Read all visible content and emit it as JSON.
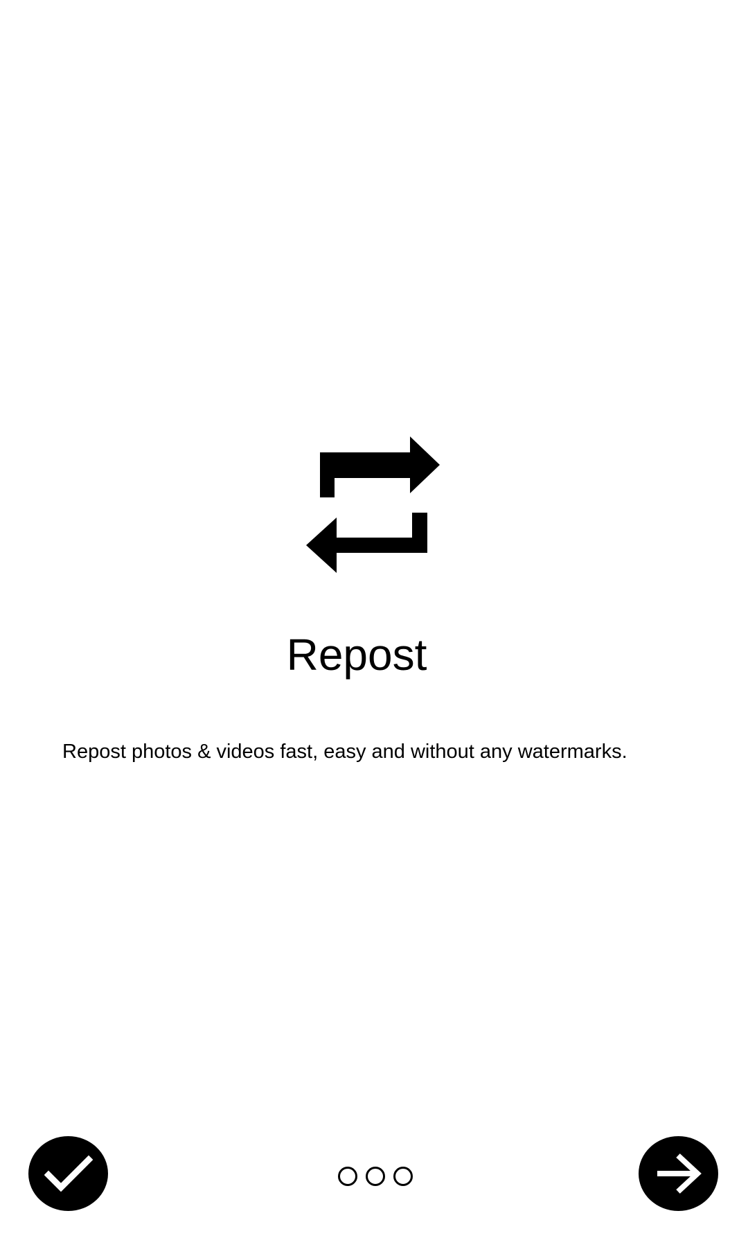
{
  "onboarding": {
    "icon": "repost-icon",
    "title": "Repost",
    "description": "Repost photos & videos fast, easy and without any watermarks.",
    "page_count": 3
  },
  "controls": {
    "done_icon": "checkmark-icon",
    "next_icon": "arrow-right-icon"
  },
  "colors": {
    "background": "#ffffff",
    "foreground": "#000000",
    "button_icon": "#ffffff"
  }
}
